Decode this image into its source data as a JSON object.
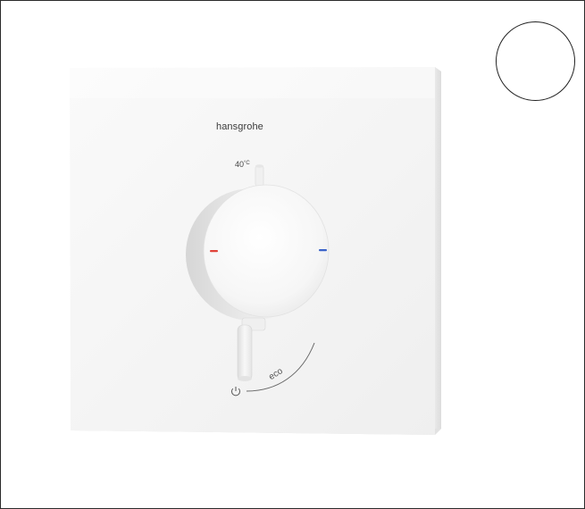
{
  "product": {
    "brand": "hansgrohe",
    "temperature_label": "40",
    "temperature_unit": "°C",
    "eco_label": "eco",
    "icons": [
      "power-icon",
      "hot-indicator",
      "cold-indicator"
    ],
    "colors": {
      "plate": "#f7f7f7",
      "knob": "#f4f4f4",
      "hot": "#e0433a",
      "cold": "#3a63c9",
      "outline": "#2b2b2b"
    }
  },
  "swatch": {
    "color": "#ffffff"
  }
}
